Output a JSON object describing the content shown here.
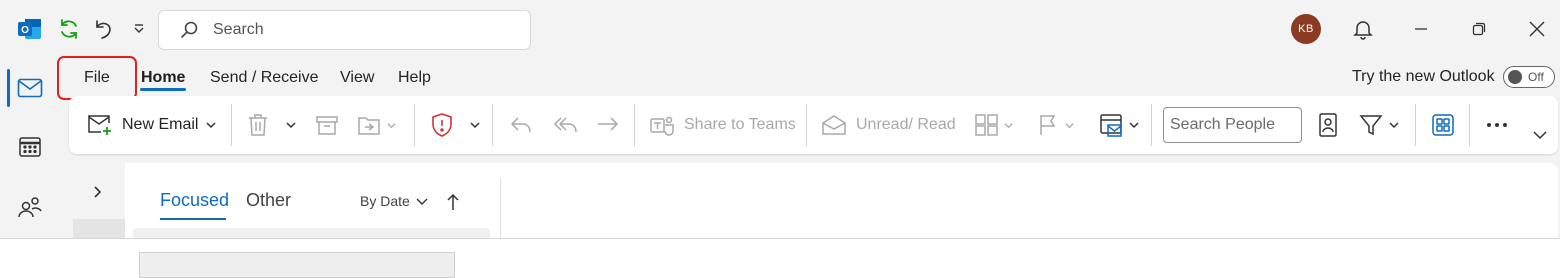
{
  "colors": {
    "accent": "#0f6cbd",
    "highlight_frame": "#e02020",
    "outlook_blue": "#0f6cbd",
    "sync_green": "#13a10e",
    "alert_red": "#d13438",
    "avatar_bg": "#8a3b22"
  },
  "titlebar": {
    "search_placeholder": "Search",
    "avatar_initials": "KB",
    "icons": [
      "outlook-app-icon",
      "sync-icon",
      "undo-icon",
      "customize-dropdown-icon",
      "search-icon",
      "bell-icon",
      "minimize-icon",
      "restore-icon",
      "close-icon"
    ]
  },
  "menu": {
    "tabs": [
      {
        "label": "File"
      },
      {
        "label": "Home"
      },
      {
        "label": "Send / Receive"
      },
      {
        "label": "View"
      },
      {
        "label": "Help"
      }
    ],
    "active_tab": "Home",
    "highlighted_tab": "File",
    "try_new": {
      "label": "Try the new Outlook",
      "toggle_state": "Off"
    }
  },
  "ribbon": {
    "new_email_label": "New Email",
    "share_to_teams_label": "Share to Teams",
    "unread_read_label": "Unread/ Read",
    "search_people_placeholder": "Search People"
  },
  "left_rail": {
    "items": [
      "mail-icon",
      "calendar-icon",
      "people-icon"
    ],
    "active": "mail-icon"
  },
  "inbox": {
    "tabs": [
      {
        "label": "Focused"
      },
      {
        "label": "Other"
      }
    ],
    "active_tab": "Focused",
    "sort_label": "By Date"
  }
}
